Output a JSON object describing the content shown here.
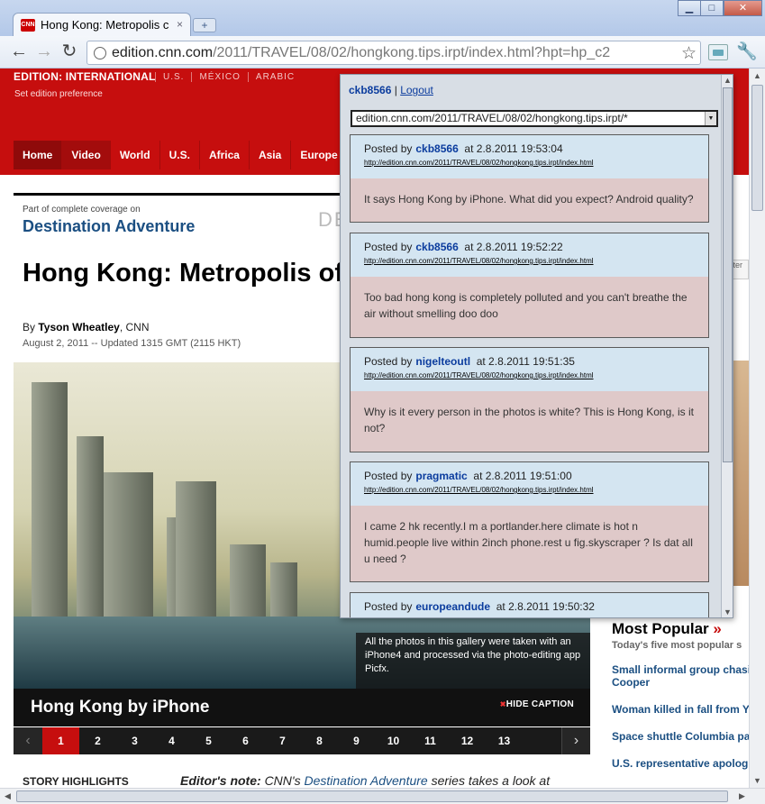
{
  "browser": {
    "tab_title": "Hong Kong: Metropolis c",
    "tab_favicon": "CNN",
    "tab_close": "×",
    "new_tab": "+",
    "url_host": "edition.cnn.com",
    "url_path": "/2011/TRAVEL/08/02/hongkong.tips.irpt/index.html?hpt=hp_c2",
    "win_minimize": "▁",
    "win_maximize": "□",
    "win_close": "✕"
  },
  "cnn": {
    "edition_label": "EDITION: INTERNATIONAL",
    "edition_links": [
      "U.S.",
      "MÉXICO",
      "ARABIC"
    ],
    "set_edition": "Set edition preference",
    "nav": [
      "Home",
      "Video",
      "World",
      "U.S.",
      "Africa",
      "Asia",
      "Europe"
    ],
    "coverage_small": "Part of complete coverage on",
    "coverage_title": "Destination Adventure",
    "coverage_logo": "DE",
    "headline": "Hong Kong: Metropolis of beauty",
    "byline_prefix": "By",
    "author": "Tyson Wheatley",
    "byline_source": ", CNN",
    "dateline": "August 2, 2011 -- Updated 1315 GMT (2115 HKT)",
    "photo_caption": "All the photos in this gallery were taken with an iPhone4 and processed via the photo-editing app Picfx.",
    "gallery_title": "Hong Kong by iPhone",
    "hide_caption": "HIDE CAPTION",
    "pages": [
      "1",
      "2",
      "3",
      "4",
      "5",
      "6",
      "7",
      "8",
      "9",
      "10",
      "11",
      "12",
      "13"
    ],
    "story_highlights": "STORY HIGHLIGHTS",
    "editors_note_label": "Editor's note:",
    "editors_note_cnn": "CNN's",
    "editors_note_link": "Destination Adventure",
    "editors_note_text": "series takes a look at",
    "most_popular": "Most Popular",
    "most_popular_sub": "Today's five most popular s",
    "popular_items": [
      "Small informal group chasi",
      "Cooper",
      "Woman killed in fall from Yo",
      "Space shuttle Columbia pa",
      "U.S. representative apologi"
    ],
    "right_strip_text": "itter"
  },
  "popup": {
    "username": "ckb8566",
    "separator": "|",
    "logout": "Logout",
    "filter_value": "edition.cnn.com/2011/TRAVEL/08/02/hongkong.tips.irpt/*",
    "comments": [
      {
        "posted_by": "Posted by",
        "user": "ckb8566",
        "time": "at 2.8.2011 19:53:04",
        "link": "http://edition.cnn.com/2011/TRAVEL/08/02/hongkong.tips.irpt/index.html",
        "text": "It says Hong Kong by iPhone. What did you expect? Android quality?"
      },
      {
        "posted_by": "Posted by",
        "user": "ckb8566",
        "time": "at 2.8.2011 19:52:22",
        "link": "http://edition.cnn.com/2011/TRAVEL/08/02/hongkong.tips.irpt/index.html",
        "text": "Too bad hong kong is completely polluted and you can't breathe the air without smelling doo doo"
      },
      {
        "posted_by": "Posted by",
        "user": "nigelteoutl",
        "time": "at 2.8.2011 19:51:35",
        "link": "http://edition.cnn.com/2011/TRAVEL/08/02/hongkong.tips.irpt/index.html",
        "text": "Why is it every person in the photos is white? This is Hong Kong, is it not?"
      },
      {
        "posted_by": "Posted by",
        "user": "pragmatic",
        "time": "at 2.8.2011 19:51:00",
        "link": "http://edition.cnn.com/2011/TRAVEL/08/02/hongkong.tips.irpt/index.html",
        "text": "I came 2 hk recently.I m a portlander.here climate is hot n humid.people live within 2inch phone.rest u fig.skyscraper ? Is dat all u need ?"
      },
      {
        "posted_by": "Posted by",
        "user": "europeandude",
        "time": "at 2.8.2011 19:50:32",
        "link": "",
        "text": ""
      }
    ]
  },
  "icons": {
    "back": "arrow-left-icon",
    "forward": "arrow-right-icon",
    "reload": "reload-icon",
    "star": "star-icon",
    "wrench": "wrench-icon",
    "extension": "extension-icon"
  }
}
